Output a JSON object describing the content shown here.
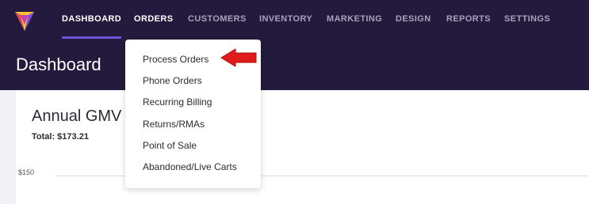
{
  "nav": {
    "items": [
      {
        "label": "DASHBOARD",
        "state": "active"
      },
      {
        "label": "ORDERS",
        "state": "open"
      },
      {
        "label": "CUSTOMERS",
        "state": ""
      },
      {
        "label": "INVENTORY",
        "state": ""
      },
      {
        "label": "MARKETING",
        "state": ""
      },
      {
        "label": "DESIGN",
        "state": ""
      },
      {
        "label": "REPORTS",
        "state": ""
      },
      {
        "label": "SETTINGS",
        "state": ""
      }
    ]
  },
  "page": {
    "title": "Dashboard"
  },
  "card": {
    "title": "Annual GMV",
    "total": "Total: $173.21",
    "y_tick": "$150"
  },
  "orders_menu": {
    "items": [
      "Process Orders",
      "Phone Orders",
      "Recurring Billing",
      "Returns/RMAs",
      "Point of Sale",
      "Abandoned/Live Carts"
    ]
  },
  "colors": {
    "header_bg": "#241a3d",
    "accent": "#6e55d9",
    "annotation_arrow": "#e11b1b"
  },
  "icons": {
    "logo": "brand-logo-icon",
    "pointer": "red-arrow-icon"
  }
}
